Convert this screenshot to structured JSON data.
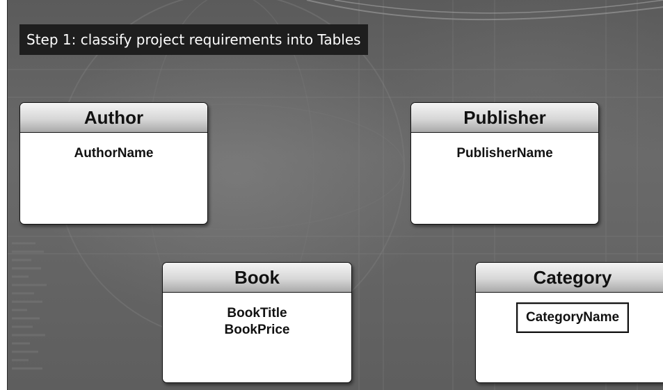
{
  "slide": {
    "title": "Step 1: classify project requirements into Tables"
  },
  "tables": {
    "author": {
      "name": "Author",
      "fields": [
        "AuthorName"
      ]
    },
    "publisher": {
      "name": "Publisher",
      "fields": [
        "PublisherName"
      ]
    },
    "book": {
      "name": "Book",
      "fields": [
        "BookTitle",
        "BookPrice"
      ]
    },
    "category": {
      "name": "Category",
      "fields": [
        "CategoryName"
      ]
    }
  },
  "colors": {
    "background": "#616161",
    "title_bar": "#1e1e1e",
    "box_fill": "#ffffff",
    "header_gradient_top": "#f4f4f4",
    "header_gradient_bottom": "#a9a9a9"
  }
}
